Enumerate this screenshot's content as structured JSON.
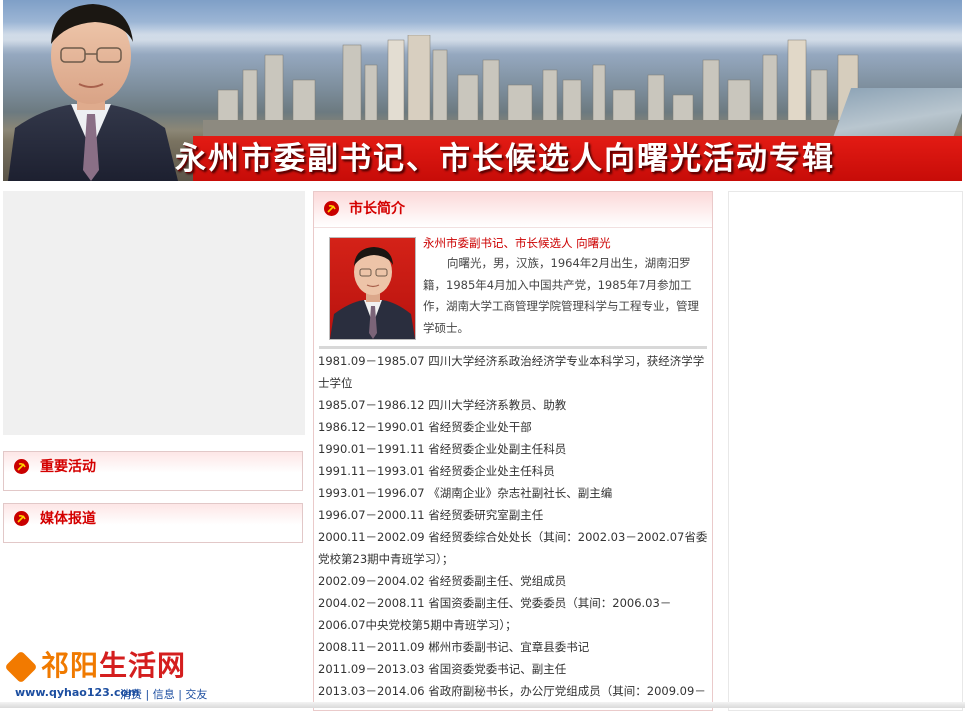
{
  "banner": {
    "title": "永州市委副书记、市长候选人向曙光活动专辑"
  },
  "left": {
    "boxes": [
      {
        "label": "重要活动"
      },
      {
        "label": "媒体报道"
      }
    ]
  },
  "center": {
    "title": "市长简介",
    "intro_name": "永州市委副书记、市长候选人 向曙光",
    "intro_text": "向曙光，男，汉族，1964年2月出生，湖南汨罗籍，1985年4月加入中国共产党，1985年7月参加工作，湖南大学工商管理学院管理科学与工程专业，管理学硕士。",
    "resume": [
      "1981.09－1985.07 四川大学经济系政治经济学专业本科学习，获经济学学士学位",
      "1985.07－1986.12 四川大学经济系教员、助教",
      "1986.12－1990.01 省经贸委企业处干部",
      "1990.01－1991.11 省经贸委企业处副主任科员",
      "1991.11－1993.01 省经贸委企业处主任科员",
      "1993.01－1996.07 《湖南企业》杂志社副社长、副主编",
      "1996.07－2000.11 省经贸委研究室副主任",
      "2000.11－2002.09 省经贸委综合处处长（其间：2002.03－2002.07省委党校第23期中青班学习）；",
      "2002.09－2004.02 省经贸委副主任、党组成员",
      "2004.02－2008.11 省国资委副主任、党委委员（其间：2006.03－2006.07中央党校第5期中青班学习）；",
      "2008.11－2011.09 郴州市委副书记、宜章县委书记",
      "2011.09－2013.03 省国资委党委书记、副主任",
      "2013.03－2014.06 省政府副秘书长，办公厅党组成员（其间：2009.09－"
    ]
  },
  "logo": {
    "name_part1": "祁阳",
    "name_part2": "生活网",
    "url": "www.qyhao123.com",
    "tags": "消费 | 信息 | 交友"
  },
  "colors": {
    "accent_red": "#d40000",
    "banner_red": "#e31b14",
    "logo_orange": "#f07a00",
    "logo_blue": "#1c4ea0"
  }
}
